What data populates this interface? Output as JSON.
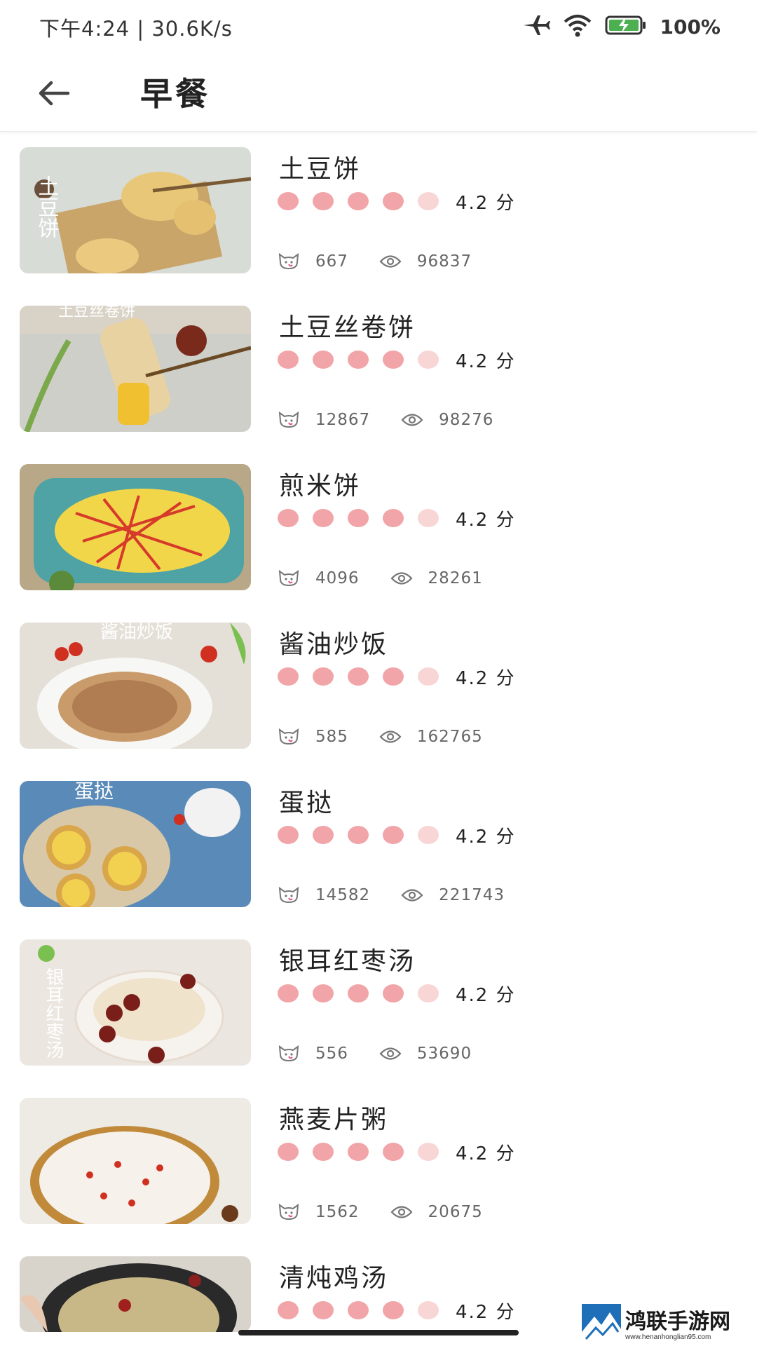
{
  "status_bar": {
    "time_speed": "下午4:24 | 30.6K/s",
    "battery_percent": "100%"
  },
  "toolbar": {
    "title": "早餐"
  },
  "recipes": [
    {
      "title": "土豆饼",
      "score": "4.2 分",
      "likes": "667",
      "views": "96837",
      "thumb_text": "土豆饼"
    },
    {
      "title": "土豆丝卷饼",
      "score": "4.2 分",
      "likes": "12867",
      "views": "98276",
      "thumb_text": "土豆丝卷饼"
    },
    {
      "title": "煎米饼",
      "score": "4.2 分",
      "likes": "4096",
      "views": "28261",
      "thumb_text": ""
    },
    {
      "title": "酱油炒饭",
      "score": "4.2 分",
      "likes": "585",
      "views": "162765",
      "thumb_text": "酱油炒饭"
    },
    {
      "title": "蛋挞",
      "score": "4.2 分",
      "likes": "14582",
      "views": "221743",
      "thumb_text": "蛋挞"
    },
    {
      "title": "银耳红枣汤",
      "score": "4.2 分",
      "likes": "556",
      "views": "53690",
      "thumb_text": "银耳红枣汤"
    },
    {
      "title": "燕麦片粥",
      "score": "4.2 分",
      "likes": "1562",
      "views": "20675",
      "thumb_text": ""
    },
    {
      "title": "清炖鸡汤",
      "score": "4.2 分",
      "likes": "",
      "views": "",
      "thumb_text": ""
    }
  ],
  "watermark": {
    "name": "鸿联手游网",
    "url": "www.henanhonglian95.com"
  },
  "colors": {
    "rating_dot": "#f2a5a8",
    "rating_dot_light": "#f9d6d6",
    "text_primary": "#222222",
    "text_secondary": "#666666"
  },
  "icons": [
    "back-arrow-icon",
    "airplane-icon",
    "wifi-icon",
    "battery-charging-icon",
    "cat-face-icon",
    "eye-icon"
  ]
}
